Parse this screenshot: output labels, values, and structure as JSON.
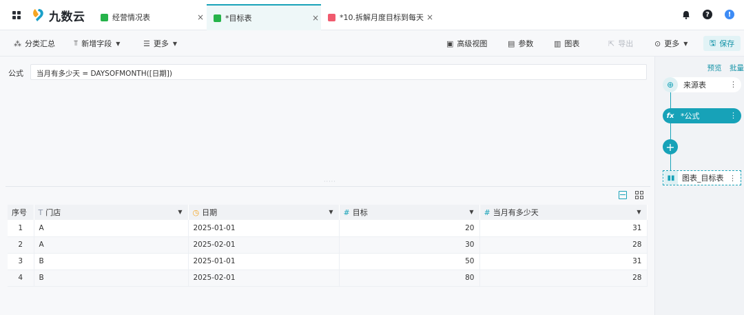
{
  "app": {
    "logo_text": "九数云",
    "brand_color": "#17a2b8"
  },
  "tabs": [
    {
      "label": "经营情况表",
      "icon": "table-icon",
      "icon_color": "#26b34a"
    },
    {
      "label": "*目标表",
      "icon": "table-icon",
      "icon_color": "#26b34a",
      "active": true
    },
    {
      "label": "*10.拆解月度目标到每天",
      "icon": "sheet-icon",
      "icon_color": "#f05a6e"
    }
  ],
  "toolbar": {
    "group_summary": "分类汇总",
    "add_field": "新增字段",
    "more": "更多",
    "advanced_view": "高级视图",
    "params": "参数",
    "chart": "图表",
    "export": "导出",
    "more2": "更多",
    "save": "保存"
  },
  "formula": {
    "label": "公式",
    "expression": "当月有多少天 = DAYSOFMONTH([日期])"
  },
  "table": {
    "columns": [
      {
        "label": "序号",
        "type_icon": ""
      },
      {
        "label": "门店",
        "type_icon": "T"
      },
      {
        "label": "日期",
        "type_icon": "◷"
      },
      {
        "label": "目标",
        "type_icon": "#"
      },
      {
        "label": "当月有多少天",
        "type_icon": "#"
      }
    ],
    "rows": [
      {
        "idx": "1",
        "store": "A",
        "date": "2025-01-01",
        "target": "20",
        "days": "31"
      },
      {
        "idx": "2",
        "store": "A",
        "date": "2025-02-01",
        "target": "30",
        "days": "28"
      },
      {
        "idx": "3",
        "store": "B",
        "date": "2025-01-01",
        "target": "50",
        "days": "31"
      },
      {
        "idx": "4",
        "store": "B",
        "date": "2025-02-01",
        "target": "80",
        "days": "28"
      }
    ]
  },
  "right_panel": {
    "preview": "预览",
    "batch": "批量",
    "nodes": [
      {
        "label": "来源表",
        "icon": "source-icon"
      },
      {
        "label": "*公式",
        "icon": "fx-icon",
        "active": true
      },
      {
        "label": "图表_目标表",
        "icon": "bar-chart-icon"
      }
    ]
  }
}
